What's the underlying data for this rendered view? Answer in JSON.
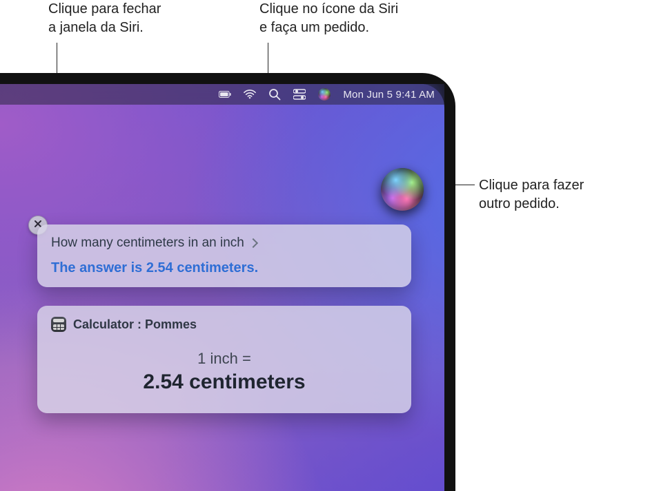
{
  "callouts": {
    "close": "Clique para fechar\na janela da Siri.",
    "menubar_siri": "Clique no ícone da Siri\ne faça um pedido.",
    "orb": "Clique para fazer\noutro pedido."
  },
  "menubar": {
    "icons": [
      "battery",
      "wifi",
      "search",
      "control-center",
      "siri"
    ],
    "clock": "Mon Jun 5  9:41 AM"
  },
  "siri": {
    "query": "How many centimeters in an inch",
    "answer": "The answer is 2.54 centimeters."
  },
  "calculator": {
    "title": "Calculator : Pommes",
    "line1": "1 inch =",
    "line2": "2.54 centimeters"
  }
}
